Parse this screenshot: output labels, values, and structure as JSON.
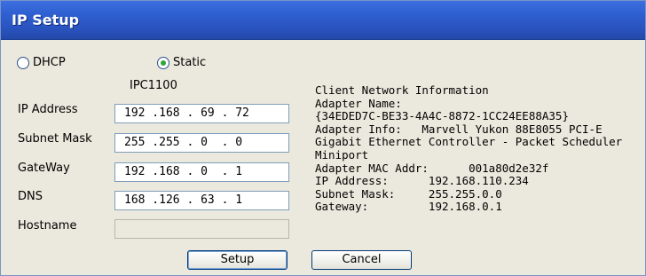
{
  "window": {
    "title": "IP Setup"
  },
  "mode": {
    "dhcp_label": "DHCP",
    "static_label": "Static",
    "selected": "Static"
  },
  "device_name": "IPC1100",
  "fields": {
    "ip_address": {
      "label": "IP Address",
      "value": "192 .168 . 69 . 72"
    },
    "subnet_mask": {
      "label": "Subnet Mask",
      "value": "255 .255 . 0  . 0"
    },
    "gateway": {
      "label": "GateWay",
      "value": "192 .168 . 0  . 1"
    },
    "dns": {
      "label": "DNS",
      "value": "168 .126 . 63 . 1"
    },
    "hostname": {
      "label": "Hostname",
      "value": ""
    }
  },
  "client_info": {
    "heading": "Client Network Information",
    "lines": [
      "Adapter Name:",
      "{34EDED7C-BE33-4A4C-8872-1CC24EE88A35}",
      "Adapter Info:   Marvell Yukon 88E8055 PCI-E",
      "Gigabit Ethernet Controller - Packet Scheduler",
      "Miniport",
      "Adapter MAC Addr:      001a80d2e32f",
      "IP Address:      192.168.110.234",
      "Subnet Mask:     255.255.0.0",
      "Gateway:         192.168.0.1"
    ]
  },
  "buttons": {
    "setup": "Setup",
    "cancel": "Cancel"
  },
  "colors": {
    "titlebar": "#2a54c0",
    "window_bg": "#ebe9dd",
    "radio_dot": "#2fa53b"
  }
}
